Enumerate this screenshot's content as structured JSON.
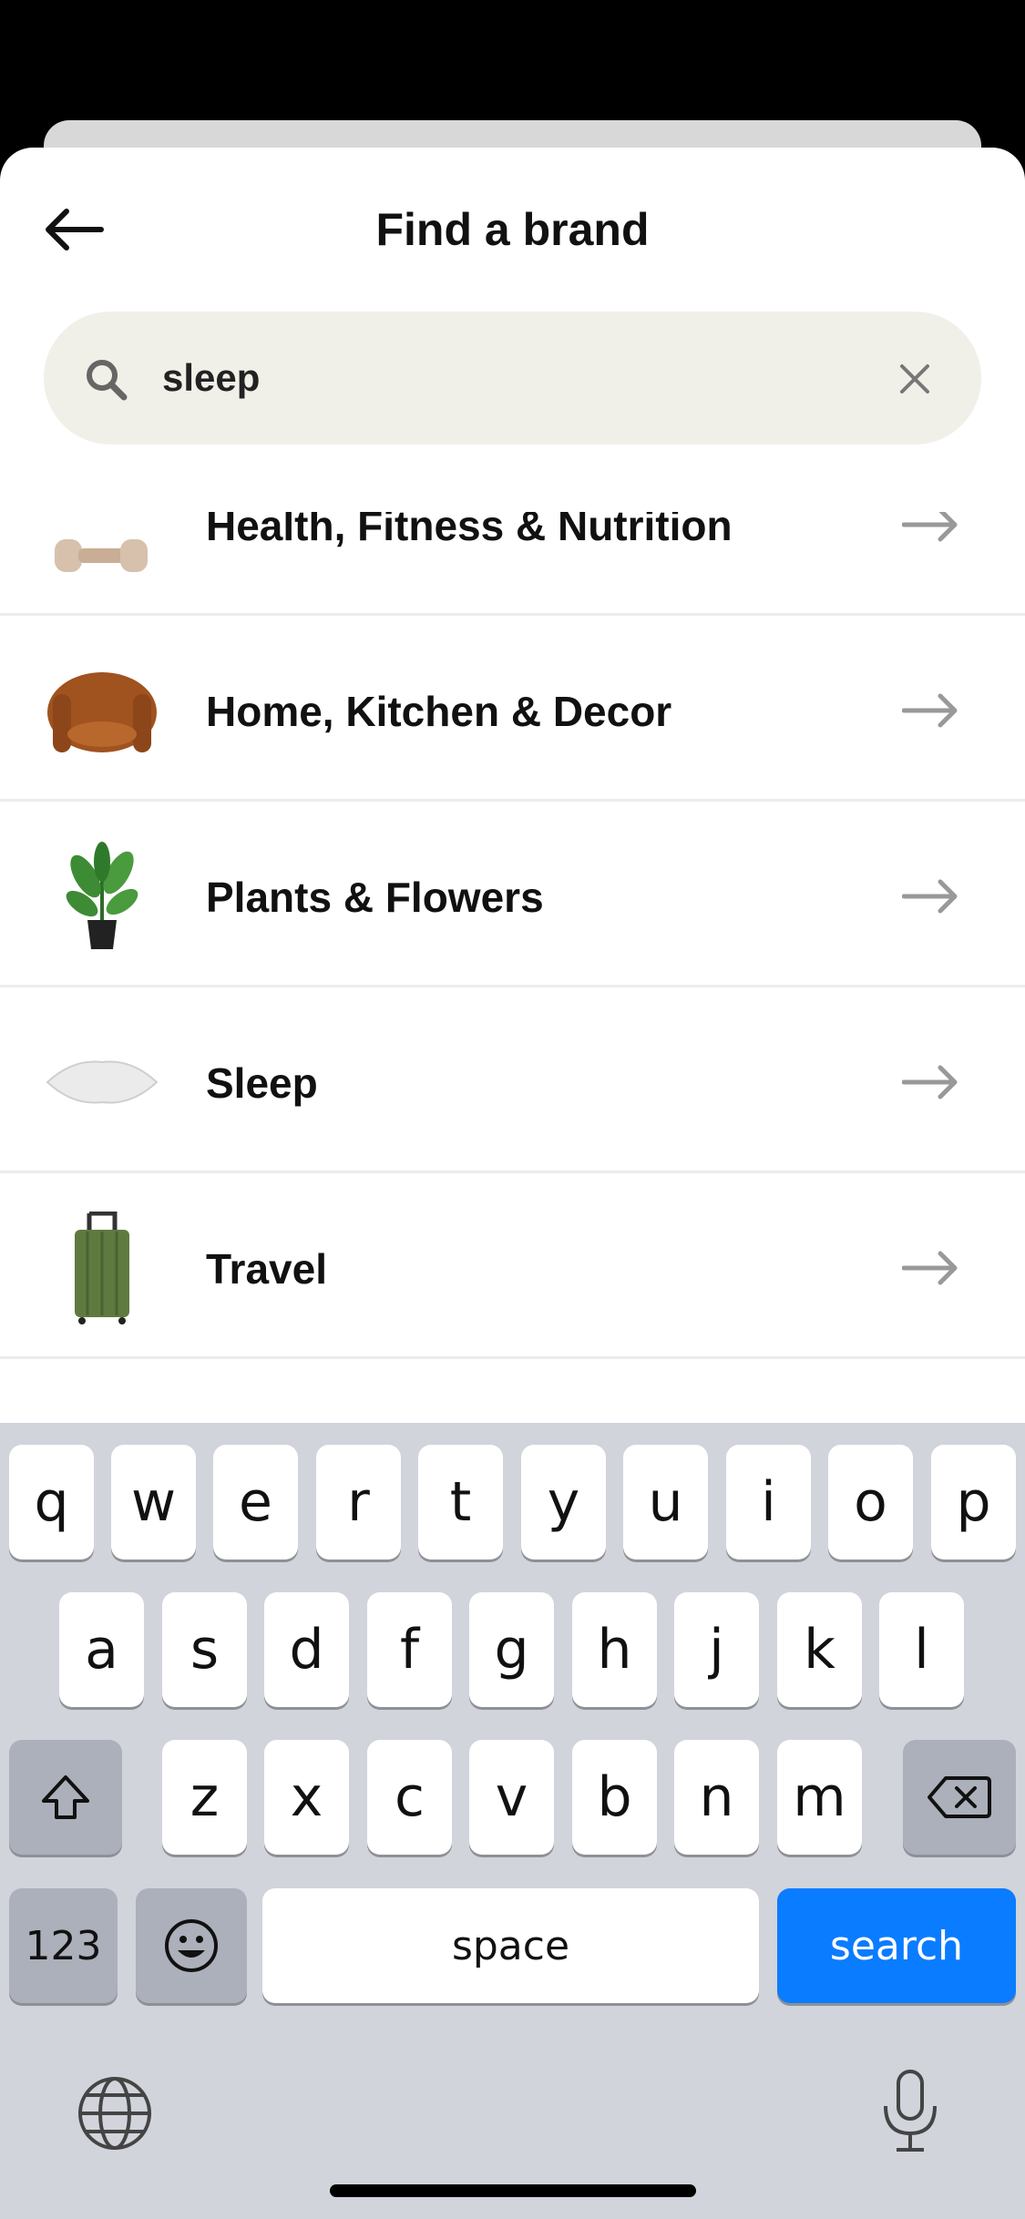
{
  "header": {
    "title": "Find a brand"
  },
  "search": {
    "value": "sleep"
  },
  "categories": [
    {
      "label": "Health, Fitness & Nutrition",
      "icon": "dumbbell-icon"
    },
    {
      "label": "Home, Kitchen & Decor",
      "icon": "armchair-icon"
    },
    {
      "label": "Plants & Flowers",
      "icon": "plant-icon"
    },
    {
      "label": "Sleep",
      "icon": "pillow-icon"
    },
    {
      "label": "Travel",
      "icon": "suitcase-icon"
    },
    {
      "label": "",
      "icon": "bottle-icon"
    }
  ],
  "keyboard": {
    "row1": [
      "q",
      "w",
      "e",
      "r",
      "t",
      "y",
      "u",
      "i",
      "o",
      "p"
    ],
    "row2": [
      "a",
      "s",
      "d",
      "f",
      "g",
      "h",
      "j",
      "k",
      "l"
    ],
    "row3": [
      "z",
      "x",
      "c",
      "v",
      "b",
      "n",
      "m"
    ],
    "numbers_label": "123",
    "space_label": "space",
    "search_label": "search"
  },
  "colors": {
    "search_bg": "#f1f0e8",
    "keyboard_bg": "#d1d4db",
    "search_key": "#0a7cff"
  }
}
